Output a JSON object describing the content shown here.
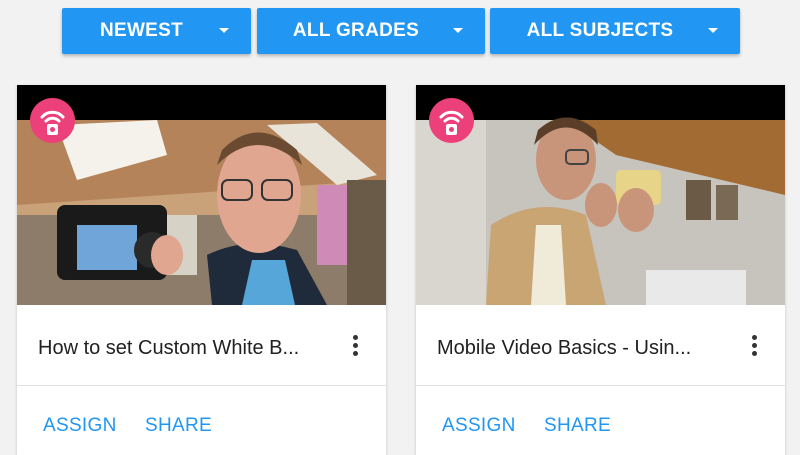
{
  "filters": {
    "sort": "NEWEST",
    "grades": "ALL GRADES",
    "subjects": "ALL SUBJECTS"
  },
  "cards": [
    {
      "title": "How to set Custom White B...",
      "assign_label": "ASSIGN",
      "share_label": "SHARE"
    },
    {
      "title": "Mobile Video Basics - Usin...",
      "assign_label": "ASSIGN",
      "share_label": "SHARE"
    }
  ],
  "colors": {
    "accent": "#2196f3",
    "badge": "#ec407a",
    "background": "#f2f2f2"
  },
  "icons": {
    "badge": "live-broadcast-icon",
    "filter_caret": "caret-down-icon",
    "card_menu": "more-vert-icon"
  }
}
